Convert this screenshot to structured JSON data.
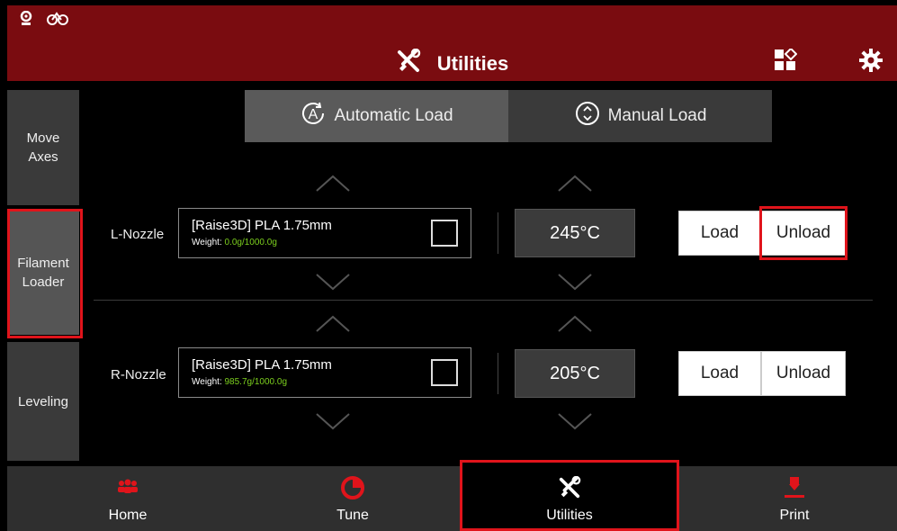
{
  "header": {
    "title": "Utilities",
    "status_icons": [
      "camera-icon",
      "link-icon"
    ],
    "right_icons": [
      "grid-shape-icon",
      "gear-icon"
    ],
    "bg_color": "#7a0c10"
  },
  "sidebar": {
    "items": [
      {
        "label": "Move Axes",
        "active": false
      },
      {
        "label": "Filament Loader",
        "active": true
      },
      {
        "label": "Leveling",
        "active": false
      }
    ]
  },
  "tabs": {
    "auto": {
      "label": "Automatic Load",
      "icon": "a-circle-icon"
    },
    "manual": {
      "label": "Manual Load",
      "icon": "updown-circle-icon"
    }
  },
  "nozzles": [
    {
      "label": "L-Nozzle",
      "filament": "[Raise3D] PLA 1.75mm",
      "weight_prefix": "Weight: ",
      "weight_value": "0.0g/1000.0g",
      "temp": "245°C",
      "load_label": "Load",
      "unload_label": "Unload"
    },
    {
      "label": "R-Nozzle",
      "filament": "[Raise3D] PLA 1.75mm",
      "weight_prefix": "Weight: ",
      "weight_value": "985.7g/1000.0g",
      "temp": "205°C",
      "load_label": "Load",
      "unload_label": "Unload"
    }
  ],
  "bottom_nav": {
    "items": [
      {
        "label": "Home",
        "icon": "users-icon"
      },
      {
        "label": "Tune",
        "icon": "pie-icon"
      },
      {
        "label": "Utilities",
        "icon": "tools-icon",
        "active": true
      },
      {
        "label": "Print",
        "icon": "print-nozzle-icon"
      }
    ]
  },
  "colors": {
    "accent_red": "#e0141b",
    "weight_green": "#7ccf1e"
  }
}
